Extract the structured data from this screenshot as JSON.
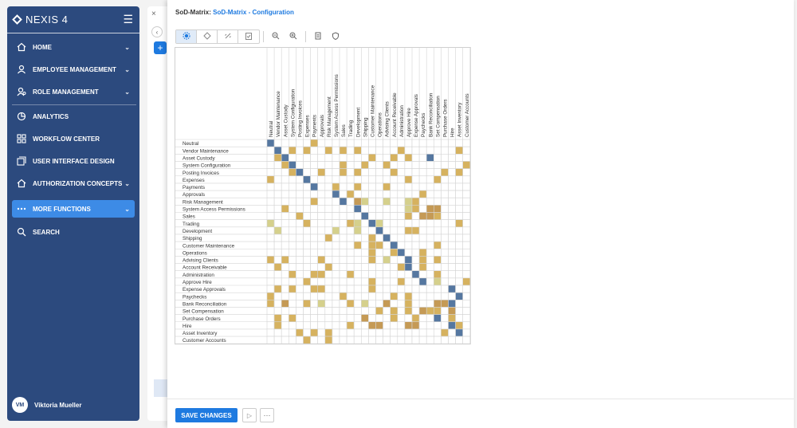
{
  "app": {
    "logo": "NEXIS 4"
  },
  "nav": {
    "home": "HOME",
    "employee": "EMPLOYEE MANAGEMENT",
    "role": "ROLE MANAGEMENT",
    "analytics": "ANALYTICS",
    "workflow": "WORKFLOW CENTER",
    "uidesign": "USER INTERFACE DESIGN",
    "authz": "AUTHORIZATION CONCEPTS",
    "more": "MORE FUNCTIONS",
    "search": "SEARCH"
  },
  "user": {
    "initials": "VM",
    "name": "Viktoria Mueller"
  },
  "bg": {
    "close": "×",
    "back": "‹",
    "plus": "+"
  },
  "title": {
    "prefix": "SoD-Matrix:",
    "link": "SoD-Matrix - Configuration"
  },
  "footer": {
    "save": "SAVE CHANGES",
    "play": "▷",
    "more": "···"
  },
  "colors": {
    "diagonal": "#5577a0",
    "conflict_a": "#d6b25f",
    "conflict_b": "#d5d08c",
    "conflict_c": "#c59a55",
    "conflict_d": "#9fae63",
    "accent": "#1e7ae0"
  },
  "matrix": {
    "labels": [
      "Neutral",
      "Vendor Maintenance",
      "Asset Custody",
      "System Configuration",
      "Posting Invoices",
      "Expenses",
      "Payments",
      "Approvals",
      "Risk Management",
      "System Access Permissions",
      "Sales",
      "Trading",
      "Development",
      "Shipping",
      "Customer Maintenance",
      "Operations",
      "Advising Clients",
      "Account Receivable",
      "Administration",
      "Approve Hire",
      "Expense Approvals",
      "Paychecks",
      "Bank Reconciliation",
      "Set Compensation",
      "Purchase Orders",
      "Hire",
      "Asset Inventory",
      "Customer Accounts"
    ],
    "cells": [
      "D.....A...................",
      ".D.A.A..A.A.A.....A.......A.",
      ".AD...........A..A.A..D.....",
      "..AD......A..A..A..........A",
      "...AD..A..A.A....A......A.A.",
      "A....D.............A...A....",
      "......D..A..A...A...........",
      ".........D.A.........A......",
      "......A...D.CB..B..BA......",
      "..A.........D......BA.CC....",
      "....A........D.....A.CCA....",
      "B....A.....AB.DB..........A.",
      ".B.......B..B..D...AA.......",
      "........A.....A.D...........",
      "............A.AA.D.....A....",
      "..............A..AD..A......",
      "A.A....A......A.B..D.A.A....",
      ".A......A.........AD.A......",
      "...A..AA...A........D..A....",
      ".....A........A...A..D.B...A",
      ".A.A..AA......A..........D..",
      "A.........A......A.A......D..",
      "A.C..A.B...A.B..C..A...CCD..",
      "...............A.A.A.CAA.C..",
      ".A.A.........C...A..A..D.A..",
      ".A.........A..CC...CC....DA",
      "....A.A.A...............A.D",
      ".....A..A...................D"
    ]
  }
}
